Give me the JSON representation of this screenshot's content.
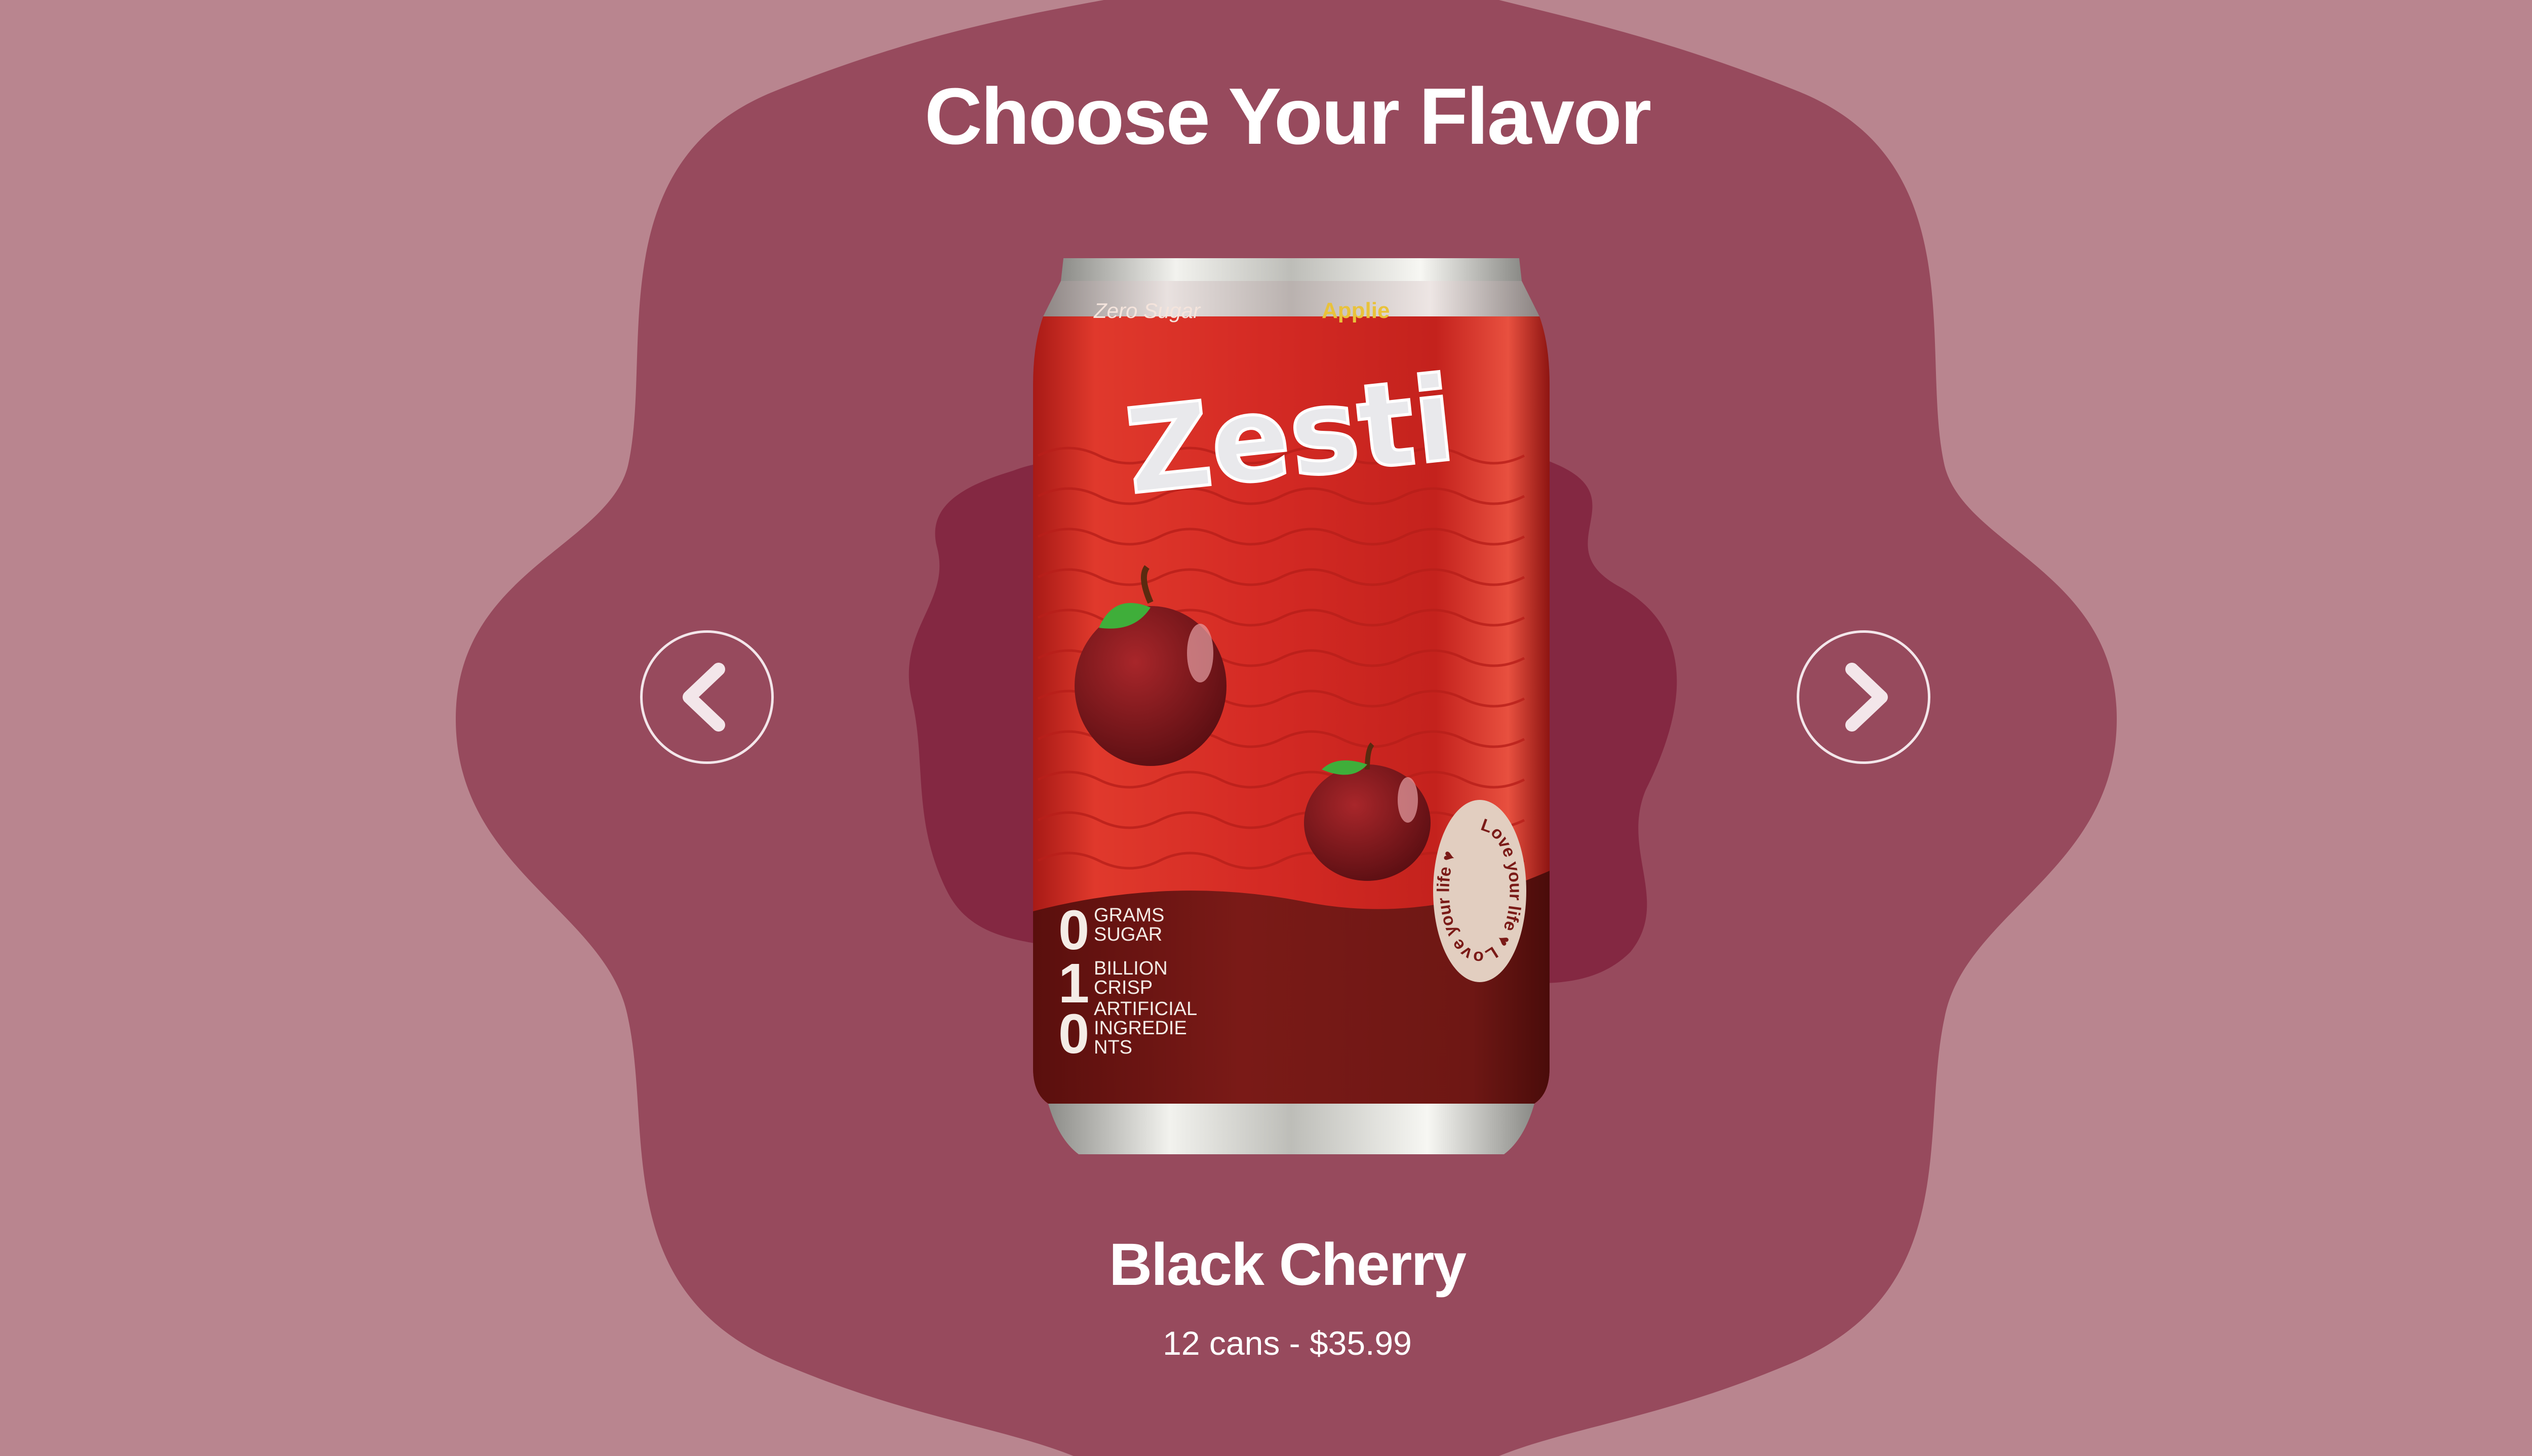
{
  "page": {
    "title": "Choose Your Flavor"
  },
  "product": {
    "name": "Black Cherry",
    "price": "12 cans - $35.99",
    "can": {
      "tagline": "Zero Sugar",
      "variant": "Applie",
      "brand": "Zesti",
      "stats": [
        {
          "num": "0",
          "text": [
            "GRAMS",
            "SUGAR"
          ]
        },
        {
          "num": "1",
          "text": [
            "BILLION",
            "CRISP"
          ]
        },
        {
          "num": "0",
          "text": [
            "ARTIFICIAL",
            "INGREDIE",
            "NTS"
          ]
        }
      ],
      "badge": "Love your life ♥ Love your life ♥"
    }
  },
  "controls": {
    "prev_icon": "chevron-left-icon",
    "next_icon": "chevron-right-icon"
  },
  "colors": {
    "page_background": "#b9858f",
    "blob_outer": "#974a5d",
    "blob_inner": "#842842",
    "can_red": "#d42a24",
    "can_dark": "#7a1a17",
    "text": "#ffffff"
  }
}
